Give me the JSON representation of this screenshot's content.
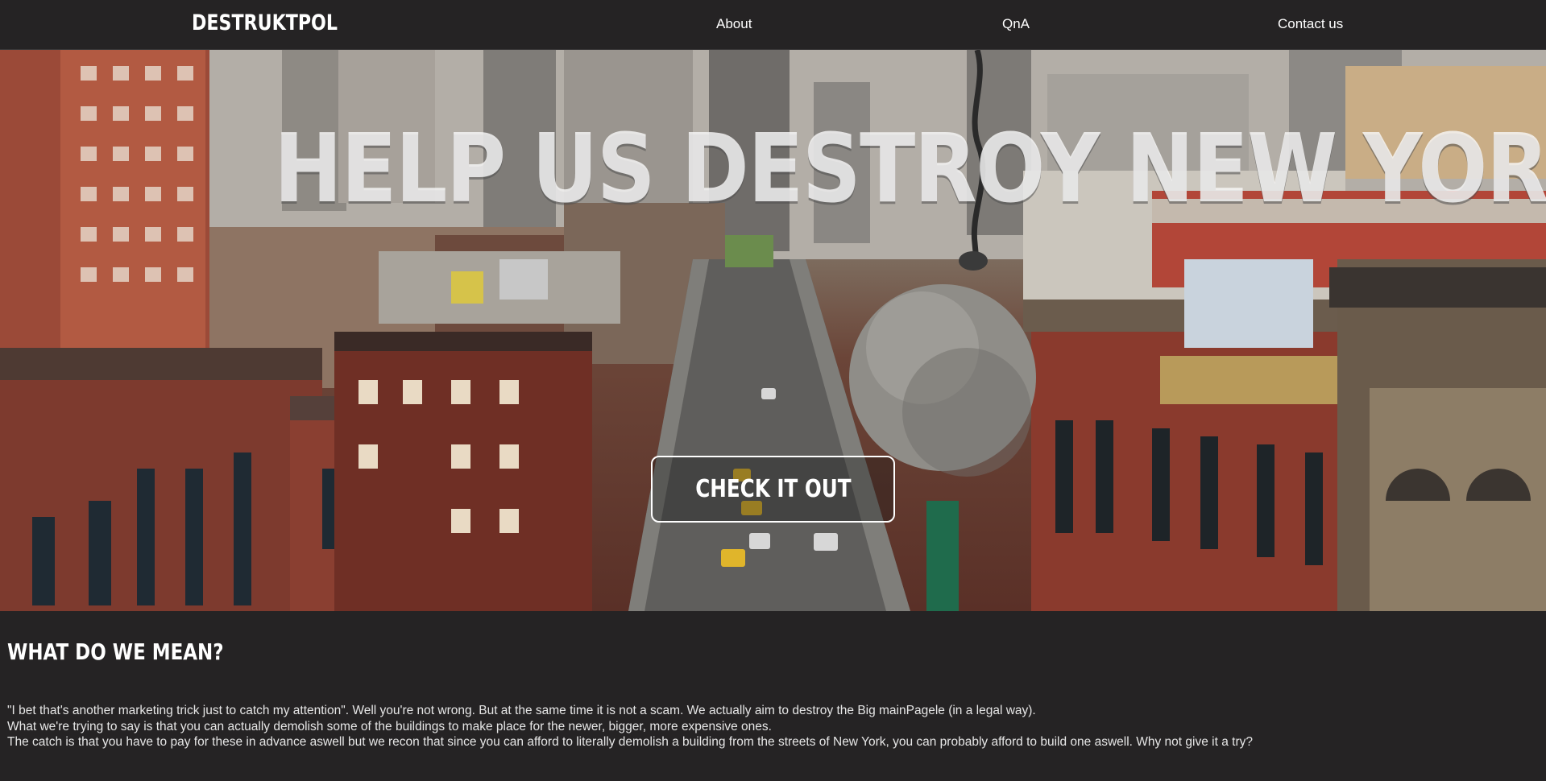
{
  "nav": {
    "brand": "DESTRUKTPOL",
    "links": [
      {
        "label": "About"
      },
      {
        "label": "QnA"
      },
      {
        "label": "Contact us"
      }
    ]
  },
  "hero": {
    "title": "HELP US DESTROY NEW YORK",
    "cta_label": "CHECK IT OUT",
    "background": "new-york-street-with-wrecking-ball"
  },
  "section": {
    "heading": "WHAT DO WE MEAN?",
    "paragraphs": [
      "\"I bet that's another marketing trick just to catch my attention\". Well you're not wrong. But at the same time it is not a scam. We actually aim to destroy the Big mainPagele (in a legal way).",
      "What we're trying to say is that you can actually demolish some of the buildings to make place for the newer, bigger, more expensive ones.",
      "The catch is that you have to pay for these in advance aswell but we recon that since you can afford to literally demolish a building from the streets of New York, you can probably afford to build one aswell. Why not give it a try?"
    ]
  },
  "colors": {
    "background": "#252324",
    "text": "#ffffff",
    "brick": "#7a3326"
  }
}
